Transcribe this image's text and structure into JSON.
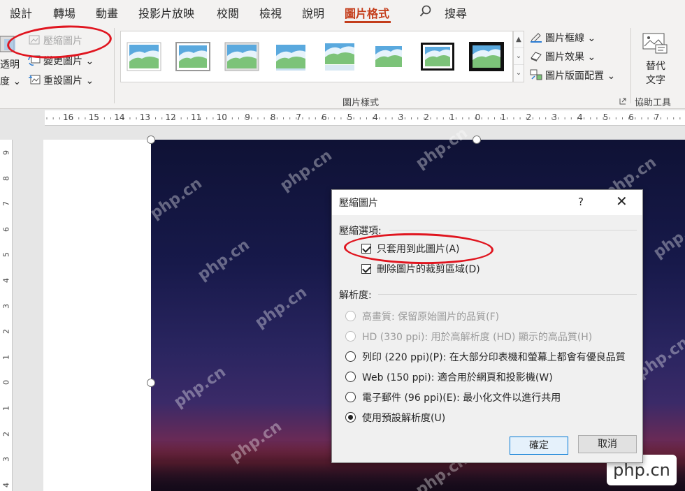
{
  "tabs": [
    {
      "label": "設計"
    },
    {
      "label": "轉場"
    },
    {
      "label": "動畫"
    },
    {
      "label": "投影片放映"
    },
    {
      "label": "校閱"
    },
    {
      "label": "檢視"
    },
    {
      "label": "說明"
    },
    {
      "label": "圖片格式"
    }
  ],
  "search_label": "搜尋",
  "ribbon": {
    "left_fragments": [
      "透明",
      "度"
    ],
    "compress_label": "壓縮圖片",
    "change_label": "變更圖片",
    "reset_label": "重設圖片",
    "styles_group_label": "圖片樣式",
    "border_label": "圖片框線",
    "effects_label": "圖片效果",
    "layout_label": "圖片版面配置",
    "alt_text_line1": "替代",
    "alt_text_line2": "文字",
    "accessibility_group_label": "協助工具"
  },
  "ruler": {
    "h_labels": [
      "16",
      "15",
      "14",
      "13",
      "12",
      "11",
      "10",
      "9",
      "8",
      "7",
      "6",
      "5",
      "4",
      "3",
      "2",
      "1",
      "0",
      "1",
      "2",
      "3",
      "4",
      "5",
      "6",
      "7"
    ],
    "v_labels": [
      "9",
      "8",
      "7",
      "6",
      "5",
      "4",
      "3",
      "2",
      "1",
      "0",
      "1",
      "2",
      "3",
      "4"
    ]
  },
  "watermark": "php.cn",
  "badge": "php.cn",
  "dialog": {
    "title": "壓縮圖片",
    "help": "?",
    "close": "✕",
    "compress_options_label": "壓縮選項:",
    "apply_only_label": "只套用到此圖片(A)",
    "delete_cropped_label": "刪除圖片的裁剪區域(D)",
    "resolution_label": "解析度:",
    "options": [
      {
        "label": "高畫質: 保留原始圖片的品質(F)",
        "disabled": true,
        "checked": false
      },
      {
        "label": "HD (330 ppi): 用於高解析度 (HD) 顯示的高品質(H)",
        "disabled": true,
        "checked": false
      },
      {
        "label": "列印 (220 ppi)(P): 在大部分印表機和螢幕上都會有優良品質",
        "disabled": false,
        "checked": false
      },
      {
        "label": "Web (150 ppi): 適合用於網頁和投影機(W)",
        "disabled": false,
        "checked": false
      },
      {
        "label": "電子郵件 (96 ppi)(E): 最小化文件以進行共用",
        "disabled": false,
        "checked": false
      },
      {
        "label": "使用預設解析度(U)",
        "disabled": false,
        "checked": true
      }
    ],
    "ok_label": "確定",
    "cancel_label": "取消"
  },
  "colors": {
    "accent": "#c43e1c",
    "annotation_red": "#e0151f",
    "ok_border": "#0078d7"
  }
}
